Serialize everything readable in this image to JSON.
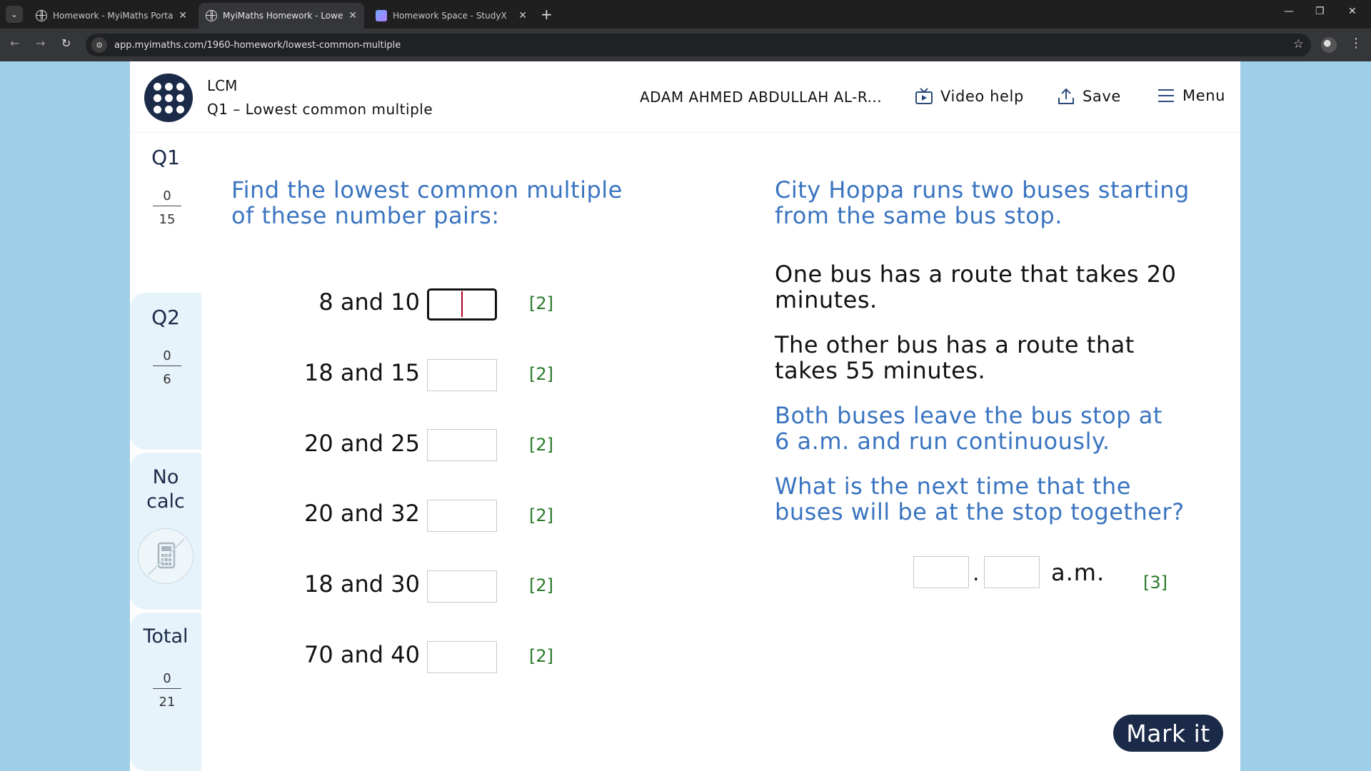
{
  "browser": {
    "tabs": [
      {
        "label": "Homework - MyiMaths Portal",
        "icon": "globe-icon",
        "active": false
      },
      {
        "label": "MyiMaths Homework - Lowest",
        "icon": "globe-icon",
        "active": true
      },
      {
        "label": "Homework Space - StudyX",
        "icon": "studyx-icon",
        "active": false
      }
    ],
    "url": "app.myimaths.com/1960-homework/lowest-common-multiple"
  },
  "header": {
    "topic": "LCM",
    "question_title": "Q1 – Lowest common multiple",
    "user_name": "ADAM AHMED ABDULLAH AL-R...",
    "video_help_label": "Video help",
    "save_label": "Save",
    "menu_label": "Menu"
  },
  "sidebar": {
    "q1": {
      "label": "Q1",
      "score": "0",
      "max": "15"
    },
    "q2": {
      "label": "Q2",
      "score": "0",
      "max": "6"
    },
    "no_calc_line1": "No",
    "no_calc_line2": "calc",
    "total": {
      "label": "Total",
      "score": "0",
      "max": "21"
    }
  },
  "q1": {
    "intro_line1": "Find the lowest common multiple",
    "intro_line2": "of these number pairs:",
    "pairs": [
      {
        "label": "8 and 10",
        "value": "",
        "marks": "[2]"
      },
      {
        "label": "18 and 15",
        "value": "",
        "marks": "[2]"
      },
      {
        "label": "20 and 25",
        "value": "",
        "marks": "[2]"
      },
      {
        "label": "20 and 32",
        "value": "",
        "marks": "[2]"
      },
      {
        "label": "18 and 30",
        "value": "",
        "marks": "[2]"
      },
      {
        "label": "70 and 40",
        "value": "",
        "marks": "[2]"
      }
    ]
  },
  "q2": {
    "intro_line1": "City Hoppa runs two buses starting",
    "intro_line2": "from the same bus stop.",
    "route1_line1": "One bus has a route that takes 20",
    "route1_line2": "minutes.",
    "route2_line1": "The other bus has a route that",
    "route2_line2": "takes 55 minutes.",
    "leave_line1": "Both buses leave the bus stop at",
    "leave_line2": "6 a.m. and run continuously.",
    "ask_line1": "What is the next time that the",
    "ask_line2": "buses will be at the stop together?",
    "hour_value": "",
    "minute_value": "",
    "separator": ".",
    "suffix": "a.m.",
    "marks": "[3]"
  },
  "mark_button_label": "Mark it",
  "colors": {
    "navy": "#1b2a48",
    "blue_text": "#3a74c0",
    "marks_green": "#2a7a2a",
    "page_bg": "#9fcfe8"
  }
}
